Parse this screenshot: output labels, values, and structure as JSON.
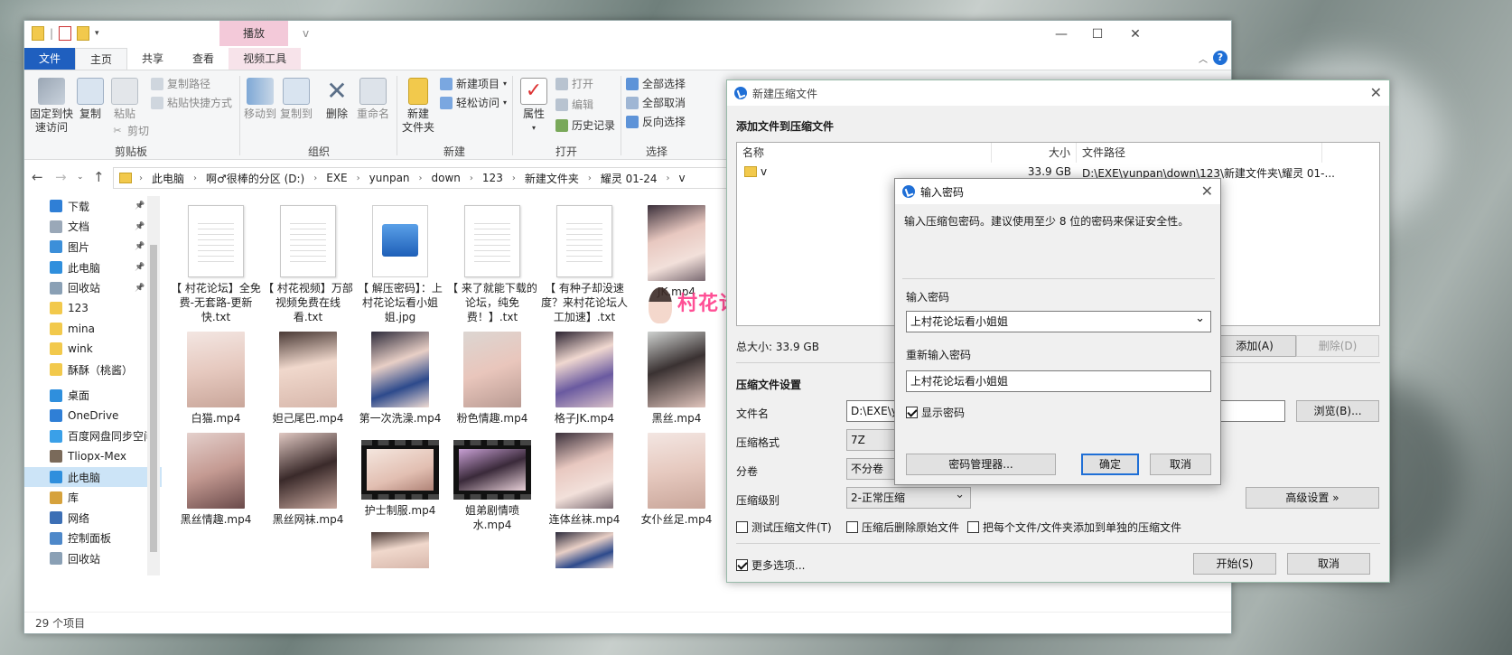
{
  "explorer": {
    "title": "v",
    "context_tab": "播放",
    "tabs": [
      "文件",
      "主页",
      "共享",
      "查看",
      "视频工具"
    ],
    "ribbon": {
      "pin_quick": "固定到快\n速访问",
      "copy": "复制",
      "paste": "粘贴",
      "copy_path": "复制路径",
      "paste_shortcut": "粘贴快捷方式",
      "cut": "剪切",
      "move_to": "移动到",
      "copy_to": "复制到",
      "delete": "删除",
      "rename": "重命名",
      "new_folder": "新建\n文件夹",
      "new_item": "新建项目",
      "easy_access": "轻松访问",
      "properties": "属性",
      "open": "打开",
      "edit": "编辑",
      "history": "历史记录",
      "select_all": "全部选择",
      "select_none": "全部取消",
      "invert_select": "反向选择",
      "groups": [
        "剪贴板",
        "组织",
        "新建",
        "打开",
        "选择"
      ]
    },
    "breadcrumbs": [
      "此电脑",
      "啊♂很棒的分区 (D:)",
      "EXE",
      "yunpan",
      "down",
      "123",
      "新建文件夹",
      "耀灵 01-24",
      "v"
    ],
    "nav_items": [
      {
        "label": "下载",
        "pinned": true,
        "icon": "download-icon"
      },
      {
        "label": "文档",
        "pinned": true,
        "icon": "document-icon"
      },
      {
        "label": "图片",
        "pinned": true,
        "icon": "picture-icon"
      },
      {
        "label": "此电脑",
        "pinned": true,
        "icon": "computer-icon"
      },
      {
        "label": "回收站",
        "pinned": true,
        "icon": "recycle-bin-icon"
      },
      {
        "label": "123",
        "pinned": false,
        "icon": "folder-icon"
      },
      {
        "label": "mina",
        "pinned": false,
        "icon": "folder-icon"
      },
      {
        "label": "wink",
        "pinned": false,
        "icon": "folder-icon"
      },
      {
        "label": "酥酥（桃酱）",
        "pinned": false,
        "icon": "folder-icon"
      },
      {
        "label": "桌面",
        "pinned": false,
        "icon": "desktop-icon"
      },
      {
        "label": "OneDrive",
        "pinned": false,
        "icon": "cloud-icon"
      },
      {
        "label": "百度网盘同步空间",
        "pinned": false,
        "icon": "cloud-sync-icon"
      },
      {
        "label": "Tliopx-Mex",
        "pinned": false,
        "icon": "user-icon"
      },
      {
        "label": "此电脑",
        "pinned": false,
        "icon": "computer-icon",
        "selected": true
      },
      {
        "label": "库",
        "pinned": false,
        "icon": "library-icon"
      },
      {
        "label": "网络",
        "pinned": false,
        "icon": "network-icon"
      },
      {
        "label": "控制面板",
        "pinned": false,
        "icon": "control-panel-icon"
      },
      {
        "label": "回收站",
        "pinned": false,
        "icon": "recycle-bin-icon"
      }
    ],
    "files": [
      {
        "name": "【 村花论坛】全免费-无套路-更新快.txt",
        "kind": "txt"
      },
      {
        "name": "【 村花视频】万部视频免费在线看.txt",
        "kind": "txt"
      },
      {
        "name": "【 解压密码】：上村花论坛看小姐姐.jpg",
        "kind": "jpg"
      },
      {
        "name": "【 来了就能下载的论坛，纯免费！】.txt",
        "kind": "txt"
      },
      {
        "name": "【 有种子却没速度？来村花论坛人工加速】.txt",
        "kind": "txt"
      },
      {
        "name": "JK.mp4",
        "kind": "photo"
      },
      {
        "name": "白猫.mp4",
        "kind": "photo"
      },
      {
        "name": "妲己尾巴.mp4",
        "kind": "photo"
      },
      {
        "name": "第一次洗澡.mp4",
        "kind": "photo"
      },
      {
        "name": "粉色情趣.mp4",
        "kind": "photo"
      },
      {
        "name": "格子JK.mp4",
        "kind": "photo"
      },
      {
        "name": "黑丝.mp4",
        "kind": "photo"
      },
      {
        "name": "黑丝情趣.mp4",
        "kind": "photo"
      },
      {
        "name": "黑丝网袜.mp4",
        "kind": "photo"
      },
      {
        "name": "护士制服.mp4",
        "kind": "film"
      },
      {
        "name": "姐弟剧情喷水.mp4",
        "kind": "film"
      },
      {
        "name": "连体丝袜.mp4",
        "kind": "photo"
      },
      {
        "name": "女仆丝足.mp4",
        "kind": "photo"
      }
    ],
    "status": "29 个项目"
  },
  "watermark": "村花论坛",
  "archive": {
    "title": "新建压缩文件",
    "heading": "添加文件到压缩文件",
    "columns": [
      "名称",
      "大小",
      "文件路径"
    ],
    "rows": [
      {
        "name": "v",
        "size": "33.9 GB",
        "path": "D:\\EXE\\yunpan\\down\\123\\新建文件夹\\耀灵 01-..."
      }
    ],
    "total": "总大小: 33.9 GB",
    "add": "添加(A)",
    "remove": "删除(D)",
    "settings_heading": "压缩文件设置",
    "filename_label": "文件名",
    "filename_value": "D:\\EXE\\yu",
    "browse": "浏览(B)...",
    "format_label": "压缩格式",
    "format_value": "7Z",
    "split_label": "分卷",
    "split_value": "不分卷",
    "level_label": "压缩级别",
    "level_value": "2-正常压缩",
    "advanced": "高级设置 »",
    "test": "测试压缩文件(T)",
    "delete_after": "压缩后删除原始文件",
    "each_separate": "把每个文件/文件夹添加到单独的压缩文件",
    "more_options": "更多选项...",
    "start": "开始(S)",
    "cancel": "取消"
  },
  "password": {
    "title": "输入密码",
    "hint": "输入压缩包密码。建议使用至少 8 位的密码来保证安全性。",
    "label1": "输入密码",
    "value1": "上村花论坛看小姐姐",
    "label2": "重新输入密码",
    "value2": "上村花论坛看小姐姐",
    "show": "显示密码",
    "manager": "密码管理器...",
    "ok": "确定",
    "cancel": "取消"
  }
}
